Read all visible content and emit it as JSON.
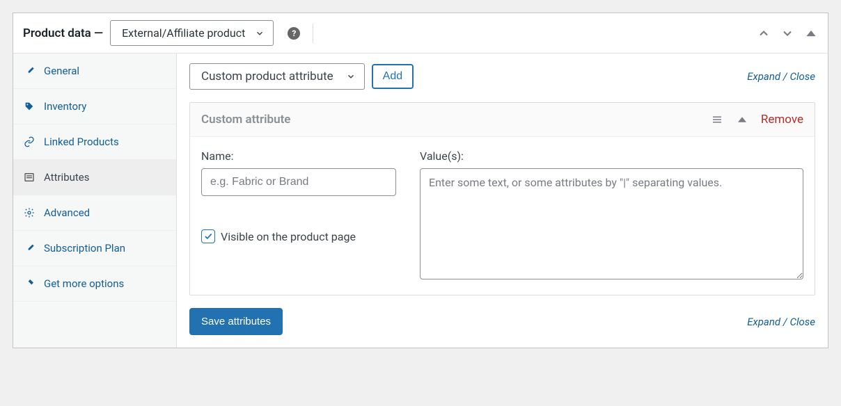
{
  "header": {
    "title": "Product data —",
    "product_type": "External/Affiliate product"
  },
  "sidebar": {
    "items": [
      {
        "label": "General"
      },
      {
        "label": "Inventory"
      },
      {
        "label": "Linked Products"
      },
      {
        "label": "Attributes"
      },
      {
        "label": "Advanced"
      },
      {
        "label": "Subscription Plan"
      },
      {
        "label": "Get more options"
      }
    ]
  },
  "main": {
    "attr_type_selected": "Custom product attribute",
    "add_button": "Add",
    "expand_label": "Expand",
    "close_label": "Close",
    "separator": " / ",
    "attribute_panel": {
      "title": "Custom attribute",
      "remove": "Remove",
      "name_label": "Name:",
      "name_placeholder": "e.g. Fabric or Brand",
      "values_label": "Value(s):",
      "values_placeholder": "Enter some text, or some attributes by \"|\" separating values.",
      "visible_label": "Visible on the product page",
      "visible_checked": true
    },
    "save_button": "Save attributes"
  }
}
